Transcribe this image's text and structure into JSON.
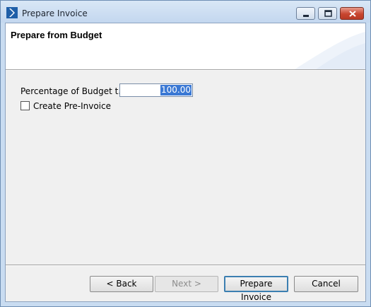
{
  "window": {
    "title": "Prepare Invoice",
    "accent_color": "#1f5fa8"
  },
  "header": {
    "title": "Prepare from Budget"
  },
  "form": {
    "percentage_label": "Percentage of Budget t...",
    "percentage_value": "100.00",
    "create_pre_invoice_label": "Create Pre-Invoice",
    "create_pre_invoice_checked": false
  },
  "buttons": {
    "back": "< Back",
    "next": "Next >",
    "prepare": "Prepare Invoice",
    "cancel": "Cancel"
  }
}
